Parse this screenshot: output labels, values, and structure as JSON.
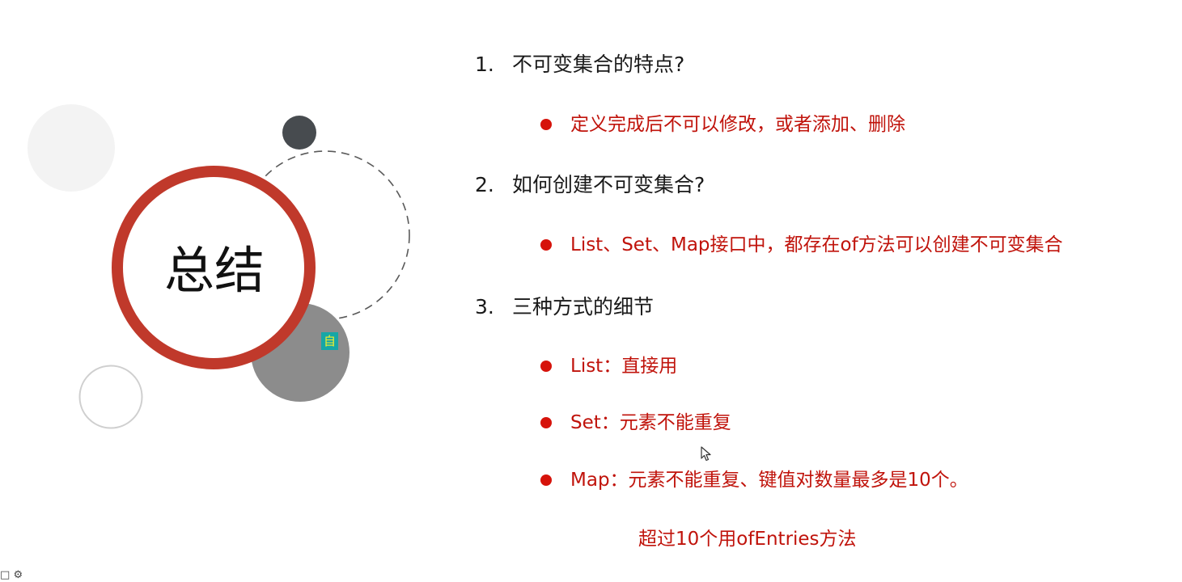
{
  "slide": {
    "title": "总结",
    "badge": "自",
    "sections": [
      {
        "number": "1.",
        "question": "不可变集合的特点?",
        "bullets": [
          "定义完成后不可以修改，或者添加、删除"
        ]
      },
      {
        "number": "2.",
        "question": "如何创建不可变集合?",
        "bullets": [
          "List、Set、Map接口中，都存在of方法可以创建不可变集合"
        ]
      },
      {
        "number": "3.",
        "question": "三种方式的细节",
        "bullets": [
          "List：直接用",
          "Set：元素不能重复",
          "Map：元素不能重复、键值对数量最多是10个。"
        ],
        "note": "超过10个用ofEntries方法"
      }
    ]
  },
  "colors": {
    "accent_red": "#c0392b",
    "bullet_red": "#d6130b",
    "text_red": "#c0130b",
    "dark_gray": "#474b4f",
    "mid_gray": "#8c8c8c",
    "light_gray": "#f3f3f3",
    "badge_bg": "#17a6a6",
    "badge_text": "#f5f02a"
  },
  "icons": [
    "mouse-cursor-icon",
    "window-icon",
    "gear-icon"
  ]
}
